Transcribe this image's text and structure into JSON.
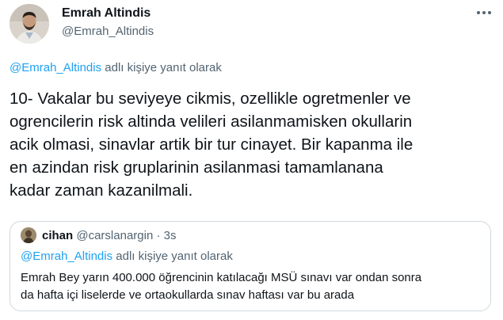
{
  "tweet": {
    "author_name": "Emrah Altindis",
    "author_handle": "@Emrah_Altindis",
    "reply_to_handle": "@Emrah_Altindis",
    "reply_suffix": " adlı kişiye yanıt olarak",
    "text": "10- Vakalar bu seviyeye cikmis, ozellikle ogretmenler ve\nogrencilerin risk altinda velileri asilanmamisken okullarin\nacik olmasi, sinavlar artik bir tur cinayet. Bir kapanma ile\nen azindan risk gruplarinin asilanmasi tamamlanana\nkadar zaman kazanilmali."
  },
  "quoted_tweet": {
    "author_name": "cihan",
    "author_handle": "@carslanargin",
    "separator": " · ",
    "time": "3s",
    "reply_to_handle": "@Emrah_Altindis",
    "reply_suffix": " adlı kişiye yanıt olarak",
    "text": "Emrah Bey yarın 400.000 öğrencinin katılacağı MSÜ sınavı var ondan sonra\nda hafta içi liselerde ve ortaokullarda sınav haftası var bu arada"
  },
  "icons": {
    "more": "more-horizontal-icon",
    "avatar": "profile-photo",
    "quoted_avatar": "profile-photo"
  },
  "colors": {
    "link": "#1da1f2",
    "secondary_text": "#536471",
    "border": "#cfd9de"
  }
}
